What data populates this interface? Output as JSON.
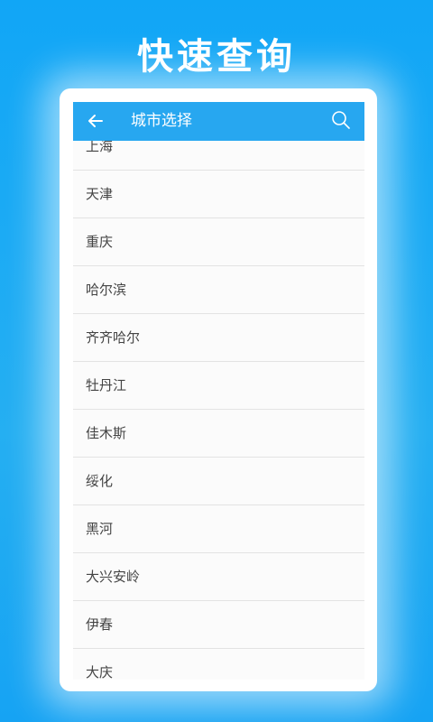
{
  "promo": {
    "title": "快速查询"
  },
  "appbar": {
    "title": "城市选择",
    "back_icon": "arrow-left-icon",
    "search_icon": "search-icon",
    "color": "#27a7f0"
  },
  "cities": [
    "上海",
    "天津",
    "重庆",
    "哈尔滨",
    "齐齐哈尔",
    "牡丹江",
    "佳木斯",
    "绥化",
    "黑河",
    "大兴安岭",
    "伊春",
    "大庆"
  ]
}
